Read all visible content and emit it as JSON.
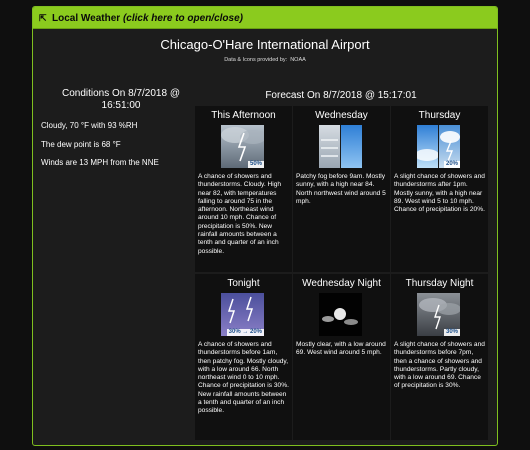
{
  "header": {
    "title": "Local Weather",
    "hint": "(click here to open/close)"
  },
  "station": "Chicago-O'Hare International Airport",
  "credit": {
    "label": "Data & Icons provided by:",
    "source": "NOAA"
  },
  "conditions": {
    "title_line1": "Conditions On 8/7/2018 @",
    "title_line2": "16:51:00",
    "summary": "Cloudy, 70 °F with 93 %RH",
    "dewpoint": "The dew point is 68 °F",
    "wind": "Winds are 13 MPH from the NNE"
  },
  "forecast": {
    "title": "Forecast On 8/7/2018 @ 15:17:01",
    "periods": [
      {
        "name": "This Afternoon",
        "icon": "thunderstorm-cloudy-icon",
        "pop": "50%",
        "desc": "A chance of showers and thunderstorms. Cloudy. High near 82, with temperatures falling to around 75 in the afternoon. Northeast wind around 10 mph. Chance of precipitation is 50%. New rainfall amounts between a tenth and quarter of an inch possible."
      },
      {
        "name": "Wednesday",
        "icon": "fog-then-sunny-icon",
        "pop": "",
        "desc": "Patchy fog before 9am. Mostly sunny, with a high near 84. North northwest wind around 5 mph."
      },
      {
        "name": "Thursday",
        "icon": "sunny-then-thunderstorm-icon",
        "pop": "20%",
        "desc": "A slight chance of showers and thunderstorms after 1pm. Mostly sunny, with a high near 89. West wind 5 to 10 mph. Chance of precipitation is 20%."
      },
      {
        "name": "Tonight",
        "icon": "night-thunderstorm-icon",
        "pop": "30% → 20%",
        "desc": "A chance of showers and thunderstorms before 1am, then patchy fog. Mostly cloudy, with a low around 66. North northeast wind 0 to 10 mph. Chance of precipitation is 30%. New rainfall amounts between a tenth and quarter of an inch possible."
      },
      {
        "name": "Wednesday Night",
        "icon": "night-clear-icon",
        "pop": "",
        "desc": "Mostly clear, with a low around 69. West wind around 5 mph."
      },
      {
        "name": "Thursday Night",
        "icon": "night-thunderstorm-cloudy-icon",
        "pop": "30%",
        "desc": "A slight chance of showers and thunderstorms before 7pm, then a chance of showers and thunderstorms. Partly cloudy, with a low around 69. Chance of precipitation is 30%."
      }
    ]
  },
  "colors": {
    "header_bg": "#8bcb1e",
    "panel_bg": "#1c1c1c",
    "cell_bg": "#101010",
    "accent_border": "#7fbf1f"
  }
}
